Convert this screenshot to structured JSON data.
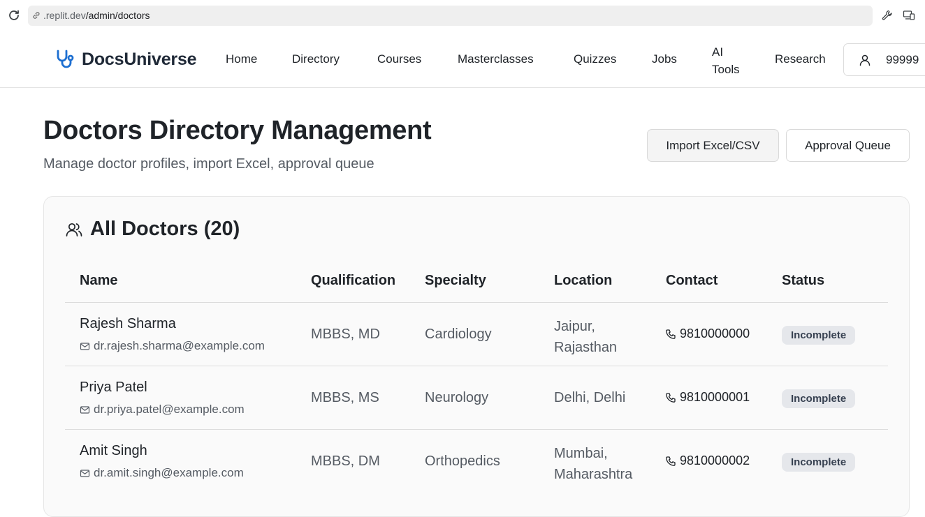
{
  "browser": {
    "url_host": ".replit.dev",
    "url_path": "/admin/doctors"
  },
  "header": {
    "brand": "DocsUniverse",
    "nav": [
      "Home",
      "Directory",
      "Courses",
      "Masterclasses",
      "Quizzes",
      "Jobs",
      "AI Tools",
      "Research"
    ],
    "nav_ai_line1": "AI",
    "nav_ai_line2": "Tools",
    "account_label": "99999"
  },
  "page": {
    "title": "Doctors Directory Management",
    "subtitle": "Manage doctor profiles, import Excel, approval queue",
    "import_button": "Import Excel/CSV",
    "queue_button": "Approval Queue"
  },
  "card": {
    "title": "All Doctors (20)",
    "columns": [
      "Name",
      "Qualification",
      "Specialty",
      "Location",
      "Contact",
      "Status"
    ],
    "rows": [
      {
        "name": "Rajesh Sharma",
        "email": "dr.rajesh.sharma@example.com",
        "qualification": "MBBS, MD",
        "specialty": "Cardiology",
        "location_line1": "Jaipur,",
        "location_line2": "Rajasthan",
        "contact": "9810000000",
        "status": "Incomplete"
      },
      {
        "name": "Priya Patel",
        "email": "dr.priya.patel@example.com",
        "qualification": "MBBS, MS",
        "specialty": "Neurology",
        "location_line1": "Delhi, Delhi",
        "location_line2": "",
        "contact": "9810000001",
        "status": "Incomplete"
      },
      {
        "name": "Amit Singh",
        "email": "dr.amit.singh@example.com",
        "qualification": "MBBS, DM",
        "specialty": "Orthopedics",
        "location_line1": "Mumbai,",
        "location_line2": "Maharashtra",
        "contact": "9810000002",
        "status": "Incomplete"
      }
    ]
  },
  "colors": {
    "brand_icon": "#1d6fd1",
    "badge_bg": "#e5e7eb"
  },
  "icons": [
    "reload-icon",
    "link-icon",
    "wrench-icon",
    "devices-icon",
    "stethoscope-icon",
    "user-icon",
    "users-icon",
    "mail-icon",
    "phone-icon"
  ]
}
